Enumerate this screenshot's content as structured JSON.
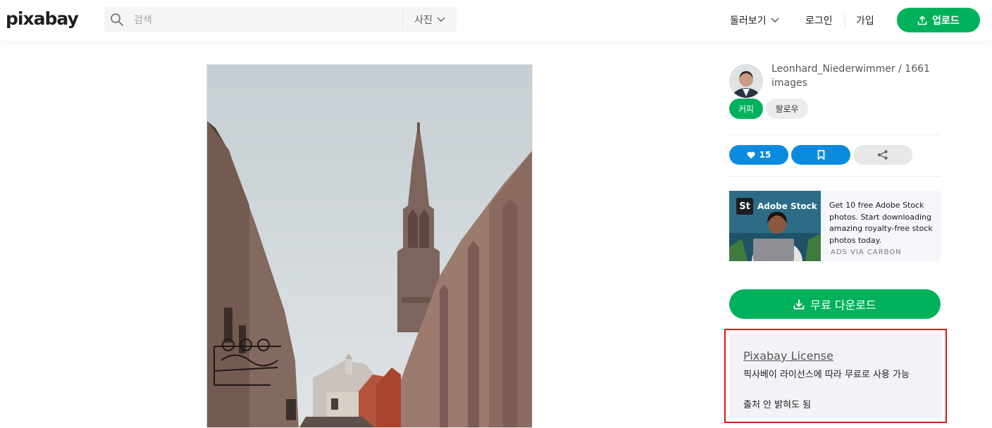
{
  "header": {
    "logo": "pixabay",
    "search_placeholder": "검색",
    "search_type": "사진",
    "explore": "둘러보기",
    "login": "로그인",
    "join": "가입",
    "upload": "업로드"
  },
  "author": {
    "name_count": "Leonhard_Niederwimmer / 1661 images",
    "coffee": "커피",
    "follow": "팔로우"
  },
  "actions": {
    "likes": "15"
  },
  "ad": {
    "brand": "Adobe Stock",
    "brand_mark": "St",
    "text": "Get 10 free Adobe Stock photos. Start downloading amazing royalty-free stock photos today.",
    "via": "ADS VIA CARBON"
  },
  "download": {
    "label": "무료 다운로드"
  },
  "license": {
    "title": "Pixabay License",
    "line1": "픽사베이 라이선스에 따라 무료로 사용 가능",
    "line2": "출처 안 밝혀도 됨"
  },
  "colors": {
    "accent_green": "#00b15c",
    "action_blue": "#0b8be0",
    "highlight_red": "#d21a1a"
  }
}
